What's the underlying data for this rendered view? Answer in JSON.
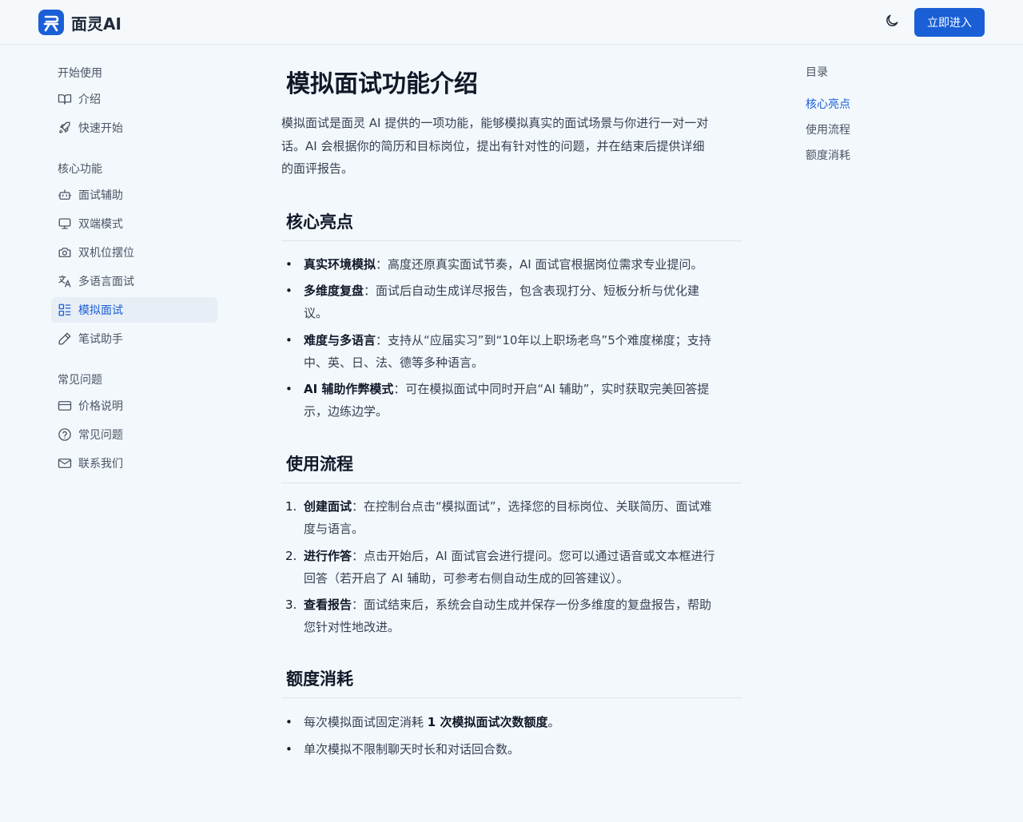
{
  "header": {
    "brand": "面灵AI",
    "enter_button": "立即进入"
  },
  "colors": {
    "accent": "#1a5fd6",
    "background": "#f3f8fd"
  },
  "sidebar": {
    "groups": [
      {
        "title": "开始使用",
        "items": [
          {
            "label": "介绍",
            "icon": "book-open-icon"
          },
          {
            "label": "快速开始",
            "icon": "rocket-icon"
          }
        ]
      },
      {
        "title": "核心功能",
        "items": [
          {
            "label": "面试辅助",
            "icon": "robot-icon"
          },
          {
            "label": "双端模式",
            "icon": "monitor-icon"
          },
          {
            "label": "双机位摆位",
            "icon": "camera-icon"
          },
          {
            "label": "多语言面试",
            "icon": "translate-icon"
          },
          {
            "label": "模拟面试",
            "icon": "layout-list-icon",
            "active": true
          },
          {
            "label": "笔试助手",
            "icon": "pencil-icon"
          }
        ]
      },
      {
        "title": "常见问题",
        "items": [
          {
            "label": "价格说明",
            "icon": "credit-card-icon"
          },
          {
            "label": "常见问题",
            "icon": "help-circle-icon"
          },
          {
            "label": "联系我们",
            "icon": "mail-icon"
          }
        ]
      }
    ]
  },
  "article": {
    "title": "模拟面试功能介绍",
    "intro_lines": [
      "模拟面试是面灵 AI 提供的一项功能，能够模拟真实的面试场景与你进行一对一对",
      "话。AI 会根据你的简历和目标岗位，提出有针对性的问题，并在结束后提供详细",
      "的面评报告。"
    ],
    "sections": [
      {
        "heading": "核心亮点",
        "items": [
          {
            "bold": "真实环境模拟",
            "lines": [
              "：高度还原真实面试节奏，AI 面试官根据岗位需求专业提问。"
            ]
          },
          {
            "bold": "多维度复盘",
            "lines": [
              "：面试后自动生成详尽报告，包含表现打分、短板分析与优化建",
              "议。"
            ]
          },
          {
            "bold": "难度与多语言",
            "lines": [
              "：支持从“应届实习”到“10年以上职场老鸟”5个难度梯度；支持",
              "中、英、日、法、德等多种语言。"
            ]
          },
          {
            "bold": "AI 辅助作弊模式",
            "lines": [
              "：可在模拟面试中同时开启“AI 辅助”，实时获取完美回答提",
              "示，边练边学。"
            ]
          }
        ]
      },
      {
        "heading": "使用流程",
        "items": [
          {
            "marker": "1.",
            "bold": "创建面试",
            "lines": [
              "：在控制台点击“模拟面试”，选择您的目标岗位、关联简历、面试难",
              "度与语言。"
            ]
          },
          {
            "marker": "2.",
            "bold": "进行作答",
            "lines": [
              "：点击开始后，AI 面试官会进行提问。您可以通过语音或文本框进行",
              "回答（若开启了 AI 辅助，可参考右侧自动生成的回答建议）。"
            ]
          },
          {
            "marker": "3.",
            "bold": "查看报告",
            "lines": [
              "：面试结束后，系统会自动生成并保存一份多维度的复盘报告，帮助",
              "您针对性地改进。"
            ]
          }
        ]
      },
      {
        "heading": "额度消耗",
        "items": [
          {
            "pre": "每次模拟面试固定消耗 ",
            "bold": "1 次模拟面试次数额度",
            "post": "。"
          },
          {
            "pre": "单次模拟不限制聊天时长和对话回合数。"
          }
        ]
      }
    ]
  },
  "toc": {
    "title": "目录",
    "items": [
      {
        "label": "核心亮点",
        "active": true
      },
      {
        "label": "使用流程"
      },
      {
        "label": "额度消耗"
      }
    ]
  }
}
